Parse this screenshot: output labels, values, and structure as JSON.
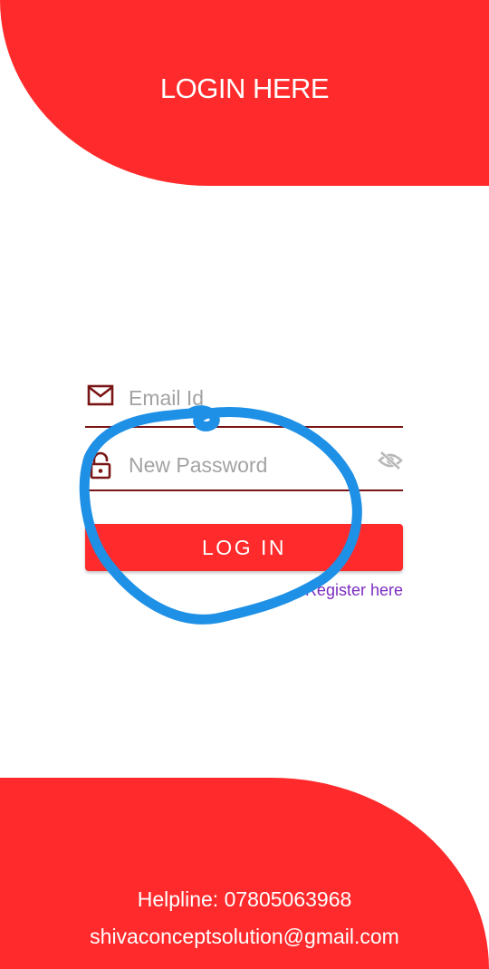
{
  "header": {
    "title": "LOGIN HERE"
  },
  "form": {
    "email": {
      "placeholder": "Email Id",
      "value": "",
      "icon": "mail-icon"
    },
    "password": {
      "placeholder": "New Password",
      "value": "",
      "icon": "lock-icon",
      "toggle_icon": "eye-off-icon"
    },
    "login_label": "LOG IN",
    "register_label": "Register here"
  },
  "footer": {
    "helpline": "Helpline: 07805063968",
    "email": "shivaconceptsolution@gmail.com"
  },
  "colors": {
    "brand": "#fe2a2b",
    "underline": "#7a1515",
    "link": "#7b2cbf",
    "annotation": "#1e90e6"
  }
}
